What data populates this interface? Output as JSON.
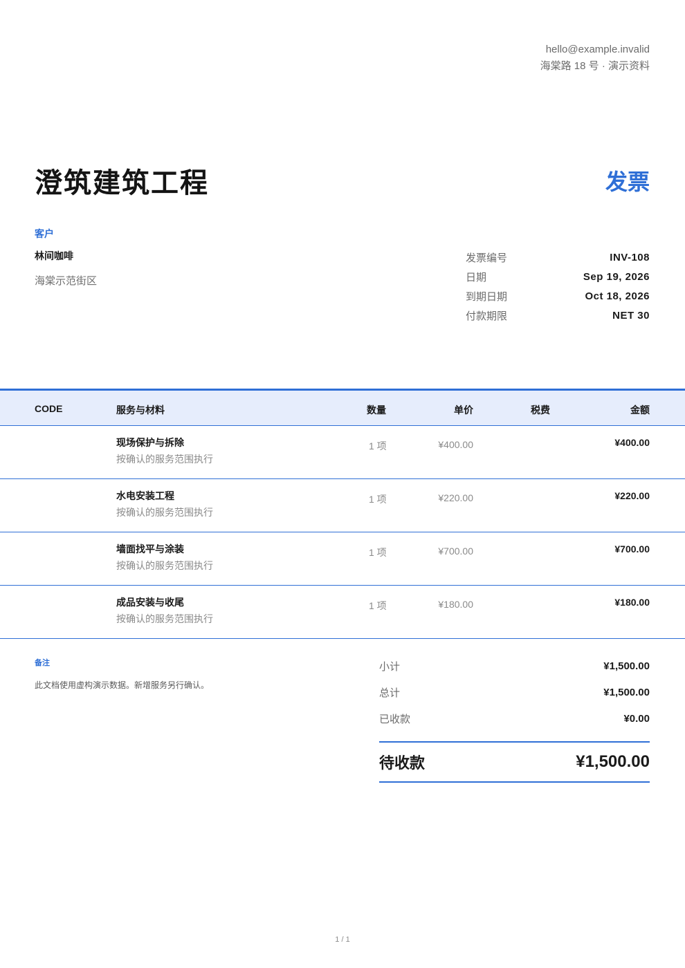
{
  "header": {
    "email": "hello@example.invalid",
    "address": "海棠路 18 号 · 演示资料",
    "company": "澄筑建筑工程",
    "doc_type": "发票"
  },
  "client": {
    "label": "客户",
    "name": "林间咖啡",
    "address": "海棠示范街区"
  },
  "meta": [
    {
      "label": "发票编号",
      "value": "INV-108"
    },
    {
      "label": "日期",
      "value": "Sep 19, 2026"
    },
    {
      "label": "到期日期",
      "value": "Oct 18, 2026"
    },
    {
      "label": "付款期限",
      "value": "NET 30"
    }
  ],
  "table": {
    "headers": {
      "code": "CODE",
      "description": "服务与材料",
      "qty": "数量",
      "unit_price": "单价",
      "tax": "税费",
      "amount": "金额"
    },
    "rows": [
      {
        "title": "现场保护与拆除",
        "sub": "按确认的服务范围执行",
        "qty": "1 项",
        "price": "¥400.00",
        "amount": "¥400.00"
      },
      {
        "title": "水电安装工程",
        "sub": "按确认的服务范围执行",
        "qty": "1 项",
        "price": "¥220.00",
        "amount": "¥220.00"
      },
      {
        "title": "墙面找平与涂装",
        "sub": "按确认的服务范围执行",
        "qty": "1 项",
        "price": "¥700.00",
        "amount": "¥700.00"
      },
      {
        "title": "成品安装与收尾",
        "sub": "按确认的服务范围执行",
        "qty": "1 项",
        "price": "¥180.00",
        "amount": "¥180.00"
      }
    ]
  },
  "notes": {
    "label": "备注",
    "text": "此文档使用虚构演示数据。新增服务另行确认。"
  },
  "totals": {
    "subtotal_label": "小计",
    "subtotal": "¥1,500.00",
    "total_label": "总计",
    "total": "¥1,500.00",
    "paid_label": "已收款",
    "paid": "¥0.00",
    "balance_label": "待收款",
    "balance": "¥1,500.00"
  },
  "footer": {
    "page": "1 / 1"
  },
  "colors": {
    "accent": "#2f6fd6",
    "header_bg": "#e6edfc"
  }
}
